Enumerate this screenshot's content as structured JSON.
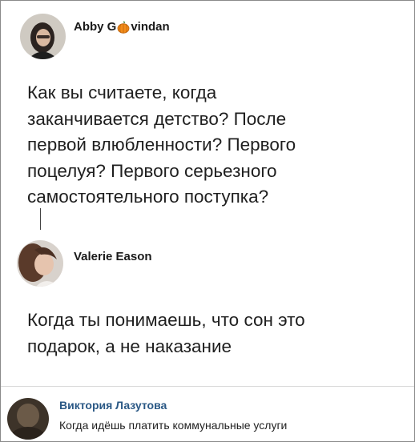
{
  "tweet1": {
    "author_name": {
      "part1": "Abby G",
      "icon": "pumpkin-icon",
      "part2": "vindan"
    },
    "text": "Как вы считаете, когда\nзаканчивается детство? После\nпервой влюбленности? Первого\nпоцелуя? Первого серьезного\nсамостоятельного поступка?"
  },
  "tweet2": {
    "author_name": "Valerie Eason",
    "text": "Когда ты понимаешь, что сон это\nподарок, а не наказание"
  },
  "comment": {
    "author_name": "Виктория Лазутова",
    "text": "Когда идёшь платить коммунальные услуги"
  },
  "colors": {
    "link": "#2a5885",
    "text": "#1f1f1f",
    "pumpkin": "#f28c1a"
  }
}
